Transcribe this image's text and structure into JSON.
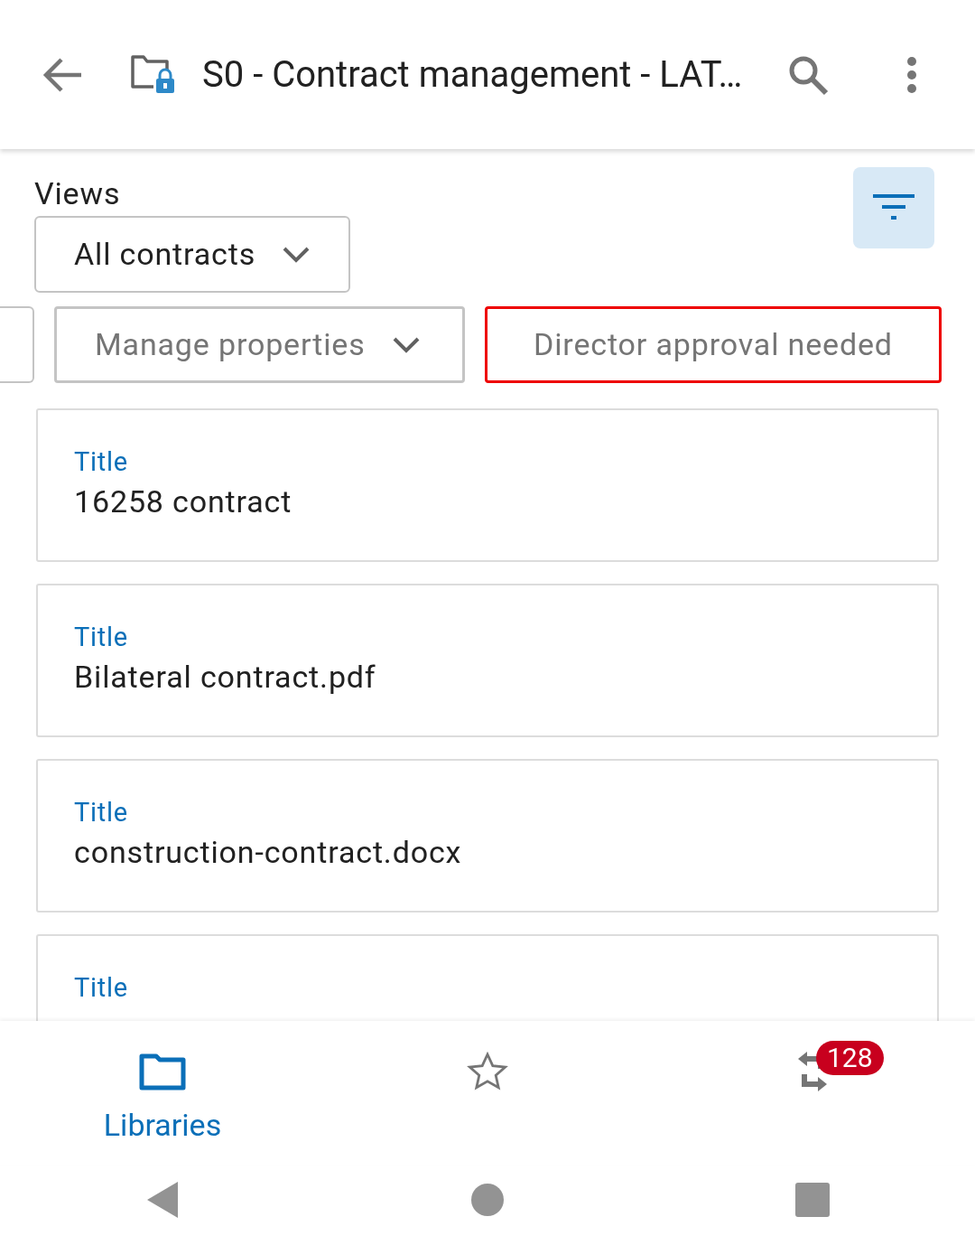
{
  "app_bar": {
    "title": "S0 - Contract management - LAT…"
  },
  "views": {
    "label": "Views",
    "selected_view": "All contracts"
  },
  "filter_button": {
    "active": true
  },
  "chips": [
    {
      "kind": "cut"
    },
    {
      "kind": "dropdown",
      "label": "Manage properties",
      "selected": false
    },
    {
      "kind": "plain",
      "label": "Director approval needed",
      "selected": true
    }
  ],
  "cards": [
    {
      "field_label": "Title",
      "value": "16258 contract"
    },
    {
      "field_label": "Title",
      "value": "Bilateral contract.pdf"
    },
    {
      "field_label": "Title",
      "value": "construction-contract.docx"
    },
    {
      "field_label": "Title"
    }
  ],
  "bottom_nav": [
    {
      "kind": "libraries",
      "label": "Libraries",
      "selected": true
    },
    {
      "kind": "favorites",
      "selected": false
    },
    {
      "kind": "sync",
      "badge": "128",
      "selected": false
    }
  ]
}
